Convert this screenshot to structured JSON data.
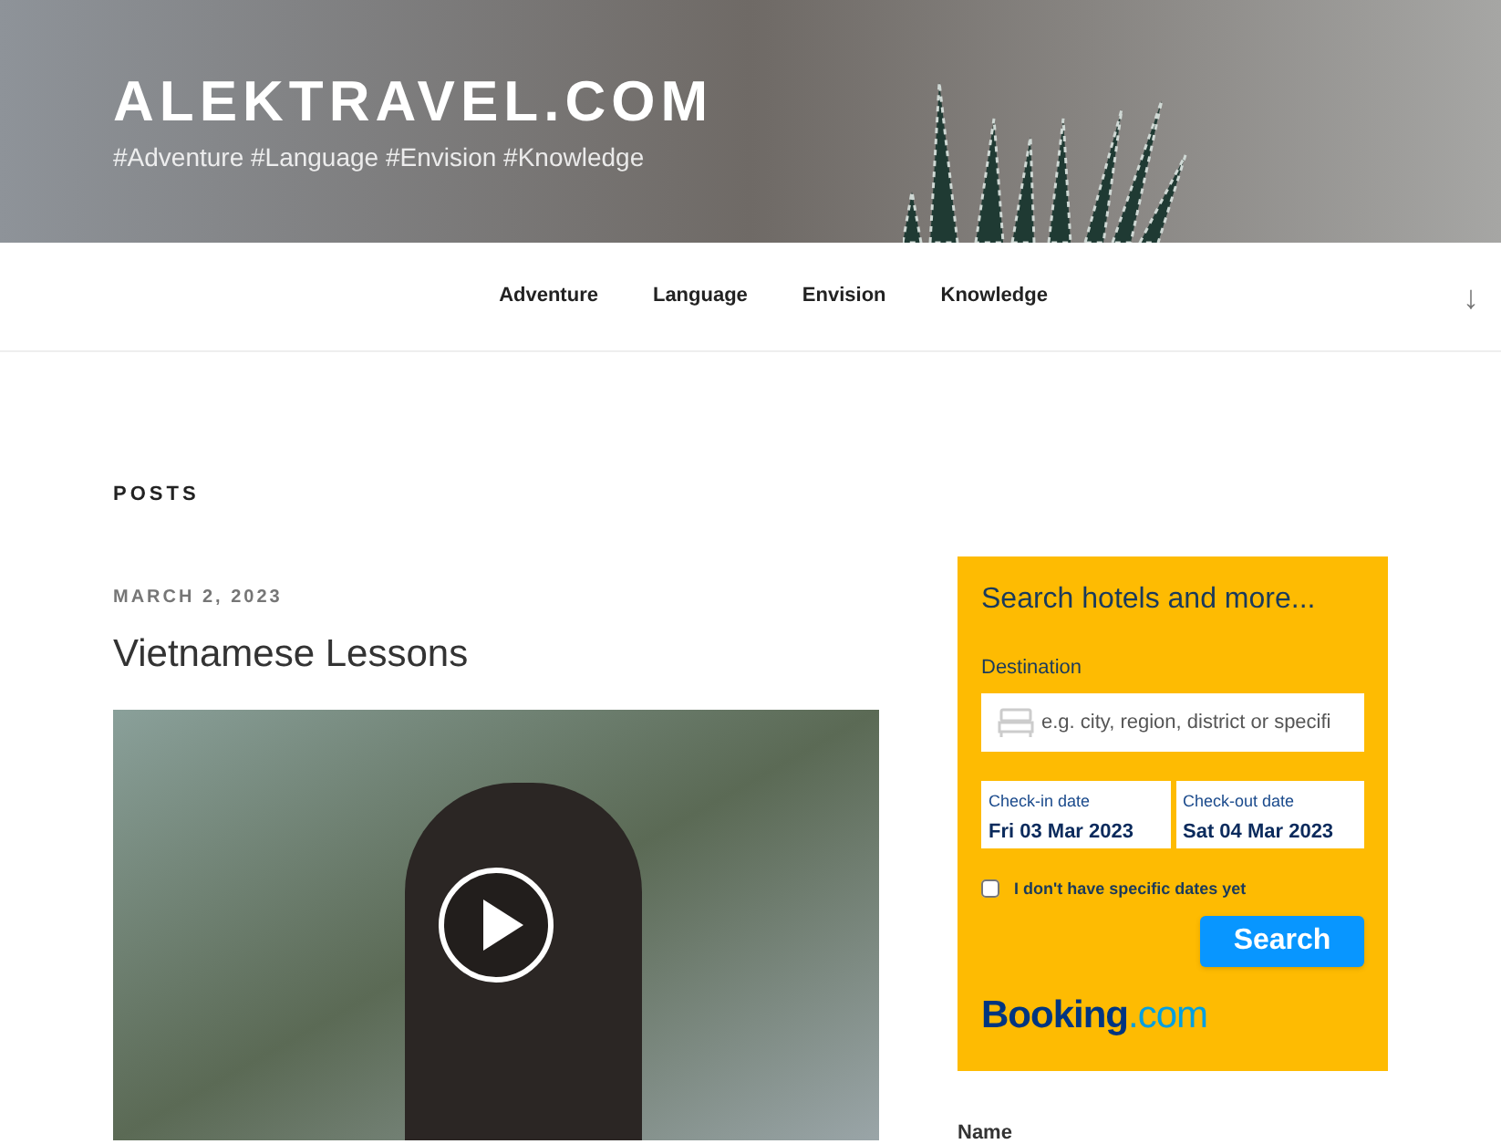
{
  "site": {
    "title": "ALEKTRAVEL.COM",
    "tagline": "#Adventure #Language #Envision #Knowledge"
  },
  "nav": {
    "items": [
      "Adventure",
      "Language",
      "Envision",
      "Knowledge"
    ],
    "scroll_icon": "↓"
  },
  "section_title": "POSTS",
  "post": {
    "date": "MARCH 2, 2023",
    "title": "Vietnamese Lessons"
  },
  "booking": {
    "heading": "Search hotels and more...",
    "destination_label": "Destination",
    "destination_placeholder": "e.g. city, region, district or specifi",
    "dates": [
      {
        "label": "Check-in date",
        "value": "Fri 03 Mar 2023"
      },
      {
        "label": "Check-out date",
        "value": "Sat 04 Mar 2023"
      }
    ],
    "no_dates": {
      "label": "I don't have specific dates yet",
      "checked": false
    },
    "search_button": "Search",
    "logo": {
      "name": "Booking",
      "suffix": ".com"
    }
  },
  "form": {
    "name_label": "Name"
  }
}
